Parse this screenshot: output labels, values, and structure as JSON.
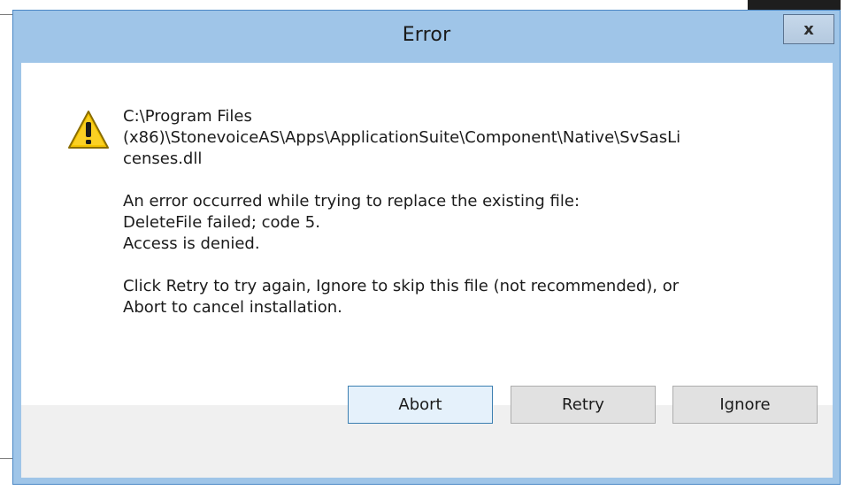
{
  "window": {
    "title": "Error",
    "close_glyph": "x"
  },
  "message": {
    "path_line1": "C:\\Program Files",
    "path_line2": "(x86)\\StonevoiceAS\\Apps\\ApplicationSuite\\Component\\Native\\SvSasLi",
    "path_line3": "censes.dll",
    "error_line1": "An error occurred while trying to replace the existing file:",
    "error_line2": "DeleteFile failed; code 5.",
    "error_line3": "Access is denied.",
    "hint_line1": "Click Retry to try again, Ignore to skip this file (not recommended), or",
    "hint_line2": "Abort to cancel installation."
  },
  "buttons": {
    "abort": "Abort",
    "retry": "Retry",
    "ignore": "Ignore"
  },
  "icons": {
    "message_icon": "warning-icon",
    "close": "close-icon"
  },
  "colors": {
    "titlebar": "#9fc5e8",
    "warning_yellow": "#f5c400",
    "default_button_border": "#3c7fb1"
  }
}
